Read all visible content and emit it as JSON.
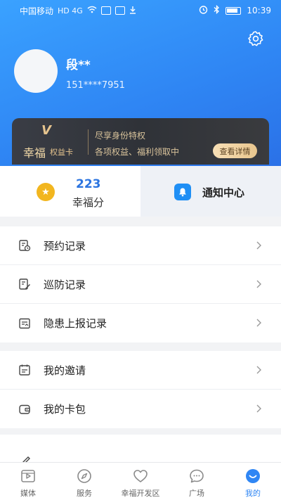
{
  "status_bar": {
    "carrier": "中国移动",
    "tags": "HD 4G",
    "time": "10:39"
  },
  "profile": {
    "name": "段**",
    "phone": "151****7951"
  },
  "vip_card": {
    "badge": "V",
    "title": "幸福",
    "subtitle": "权益卡",
    "line1": "尽享身份特权",
    "line2": "各项权益、福利领取中",
    "button": "查看详情"
  },
  "stats": {
    "score_value": "223",
    "score_label": "幸福分",
    "notify_label": "通知中心"
  },
  "menu_group1": [
    {
      "label": "预约记录",
      "icon": "calendar-clock-icon"
    },
    {
      "label": "巡防记录",
      "icon": "edit-doc-icon"
    },
    {
      "label": "隐患上报记录",
      "icon": "report-icon"
    }
  ],
  "menu_group2": [
    {
      "label": "我的邀请",
      "icon": "calendar-icon"
    },
    {
      "label": "我的卡包",
      "icon": "wallet-icon"
    }
  ],
  "bottom_nav": [
    {
      "label": "媒体",
      "icon": "media-play-icon"
    },
    {
      "label": "服务",
      "icon": "compass-icon"
    },
    {
      "label": "幸福开发区",
      "icon": "heart-icon"
    },
    {
      "label": "广场",
      "icon": "chat-bubble-icon"
    },
    {
      "label": "我的",
      "icon": "smile-face-icon"
    }
  ],
  "colors": {
    "header": "#2f86f4",
    "accent": "#2f86f4",
    "vip_gold": "#e6c48e",
    "score": "#2b74e0"
  }
}
